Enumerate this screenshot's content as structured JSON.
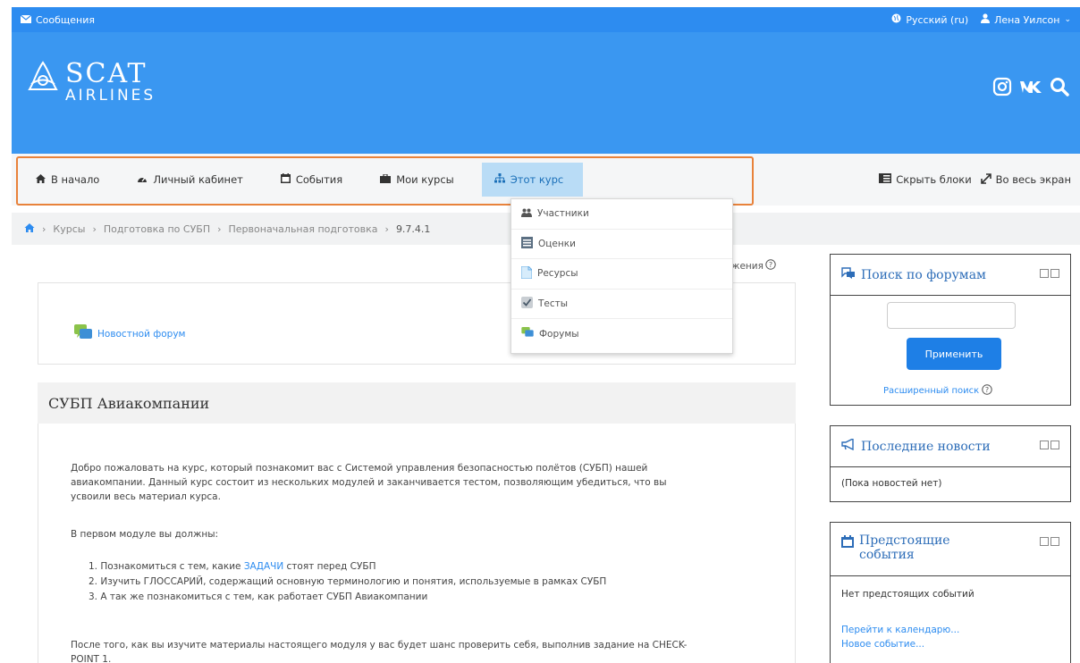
{
  "topbar": {
    "messages_label": "Сообщения",
    "language_label": "Русский (ru)",
    "user_name": "Лена Уилсон"
  },
  "logo": {
    "line1": "SCAT",
    "line2": "AIRLINES"
  },
  "colors": {
    "brand_blue": "#3a97f1",
    "topbar_blue": "#2d8cf0",
    "highlight_orange": "#e8823b",
    "active_tab": "#b9dcf6"
  },
  "nav": {
    "items": [
      {
        "label": "В начало",
        "icon": "home-icon"
      },
      {
        "label": "Личный кабинет",
        "icon": "dashboard-icon"
      },
      {
        "label": "События",
        "icon": "calendar-icon"
      },
      {
        "label": "Мои курсы",
        "icon": "briefcase-icon"
      },
      {
        "label": "Этот курс",
        "icon": "sitemap-icon"
      }
    ],
    "hide_blocks_label": "Скрыть блоки",
    "fullscreen_label": "Во весь экран"
  },
  "breadcrumb": {
    "items": [
      "Курсы",
      "Подготовка по СУБП",
      "Первоначальная подготовка",
      "9.7.4.1"
    ]
  },
  "dropdown": {
    "items": [
      {
        "label": "Участники",
        "icon": "users-icon"
      },
      {
        "label": "Оценки",
        "icon": "grades-icon"
      },
      {
        "label": "Ресурсы",
        "icon": "file-icon"
      },
      {
        "label": "Тесты",
        "icon": "quiz-icon"
      },
      {
        "label": "Форумы",
        "icon": "forum-icon"
      }
    ]
  },
  "main": {
    "edit_hint": "жения",
    "news_forum_label": "Новостной форум",
    "section_title": "СУБП Авиакомпании",
    "intro_line1": "Добро пожаловать на курс, который познакомит вас с Системой управления безопасностью полётов (СУБП) нашей",
    "intro_line2": "авиакомпании. Данный курс состоит из нескольких модулей и заканчивается тестом, позволяющим убедиться, что вы",
    "intro_line3": "усвоили весь материал курса.",
    "module_intro": "В первом модуле вы должны:",
    "list": {
      "item1_before": "1. Познакомиться с тем, какие ",
      "item1_link": "ЗАДАЧИ",
      "item1_after": " стоят перед СУБП",
      "item2": "2. Изучить ГЛОССАРИЙ, содержащий основную терминологию и понятия, используемые в рамках СУБП",
      "item3": "3. А так же познакомиться с тем, как работает СУБП Авиакомпании"
    },
    "after_line1": "После того, как вы изучите материалы настоящего модуля у вас будет шанс проверить себя, выполнив задание на CHECK-",
    "after_line2": "POINT 1."
  },
  "blocks": {
    "forum_search": {
      "title": "Поиск по форумам",
      "input_value": "",
      "apply_label": "Применить",
      "advanced_label": "Расширенный поиск"
    },
    "latest_news": {
      "title": "Последние новости",
      "empty_text": "(Пока новостей нет)"
    },
    "upcoming": {
      "title_line1": "Предстоящие",
      "title_line2": "события",
      "empty_text": "Нет предстоящих событий",
      "goto_calendar": "Перейти к календарю...",
      "new_event": "Новое событие..."
    }
  }
}
